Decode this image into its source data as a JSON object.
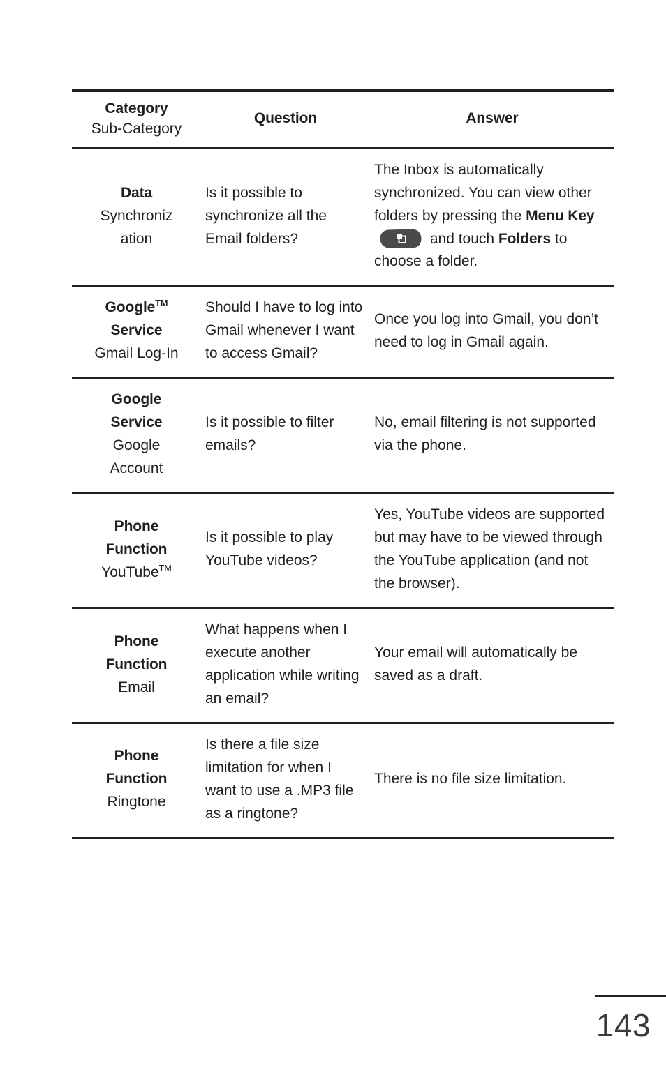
{
  "document": {
    "page_number": "143",
    "table": {
      "headers": {
        "category_main": "Category",
        "category_sub": "Sub-Category",
        "question": "Question",
        "answer": "Answer"
      },
      "rows": [
        {
          "category": "Data",
          "sub_category_line1": "Synchroniz",
          "sub_category_line2": "ation",
          "question": "Is it possible to synchronize all the Email folders?",
          "answer_part1": "The Inbox is automatically synchronized. You can view other folders by pressing the ",
          "answer_bold1": "Menu Key",
          "answer_icon": "menu-key-icon",
          "answer_part2": " and touch ",
          "answer_bold2": "Folders",
          "answer_part3": "  to choose a folder."
        },
        {
          "category": "Google",
          "category_tm": "TM",
          "category_line2": "Service",
          "sub_category_line1": "Gmail Log-In",
          "question": "Should I have to log into Gmail whenever I want to access Gmail?",
          "answer": "Once you log into Gmail, you don’t need to log in Gmail again."
        },
        {
          "category": "Google",
          "category_line2": "Service",
          "sub_category_line1": "Google",
          "sub_category_line2": "Account",
          "question": "Is it possible to filter emails?",
          "answer": "No, email filtering is not supported via the phone."
        },
        {
          "category": "Phone",
          "category_line2": "Function",
          "sub_category_line1": "YouTube",
          "sub_category_tm": "TM",
          "question": "Is it possible to play YouTube videos?",
          "answer": "Yes, YouTube videos are supported but may have to be viewed through the YouTube application (and not the browser)."
        },
        {
          "category": "Phone",
          "category_line2": "Function",
          "sub_category_line1": "Email",
          "question": "What happens when I execute another application while writing an email?",
          "answer": "Your email will automatically be saved as a draft."
        },
        {
          "category": "Phone",
          "category_line2": "Function",
          "sub_category_line1": "Ringtone",
          "question": "Is there a file size limitation for when I want to use a .MP3 file as a ringtone?",
          "answer": "There is no file size limitation."
        }
      ]
    },
    "colors": {
      "text": "#231f20",
      "rule": "#231f20",
      "icon_body": "#4a4a4a",
      "icon_glyph": "#ffffff",
      "page_number": "#3a3a3a"
    }
  }
}
